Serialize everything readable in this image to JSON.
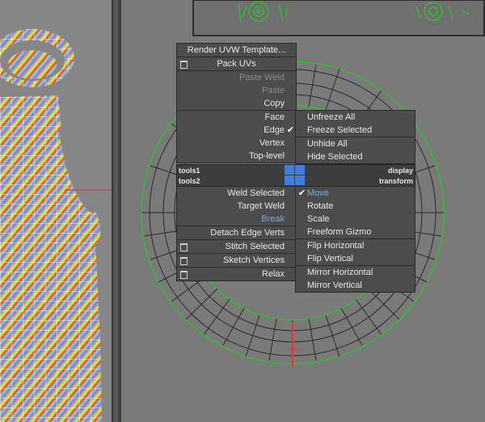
{
  "colors": {
    "seam_green": "#22d022",
    "menu_bg": "#4c4c4c",
    "highlight_blue": "#3f7fe0"
  },
  "quad_left": {
    "items": [
      {
        "label": "Render UVW Template...",
        "state": "normal",
        "align": "center"
      },
      {
        "label": "Pack UVs",
        "state": "normal",
        "align": "center",
        "icon": "box-icon"
      },
      {
        "label": "Paste Weld",
        "state": "disabled"
      },
      {
        "label": "Paste",
        "state": "disabled"
      },
      {
        "label": "Copy",
        "state": "normal"
      },
      {
        "label": "Face",
        "state": "normal"
      },
      {
        "label": "Edge",
        "state": "normal",
        "check": true
      },
      {
        "label": "Vertex",
        "state": "normal"
      },
      {
        "label": "Top-level",
        "state": "normal"
      }
    ]
  },
  "quad_bottom_left": {
    "items": [
      {
        "label": "Weld Selected",
        "state": "normal"
      },
      {
        "label": "Target Weld",
        "state": "normal"
      },
      {
        "label": "Break",
        "state": "blue"
      },
      {
        "label": "Detach Edge Verts",
        "state": "normal"
      },
      {
        "label": "Stitch Selected",
        "state": "normal",
        "icon": "box-icon"
      },
      {
        "label": "Sketch Vertices",
        "state": "normal",
        "icon": "box-icon"
      },
      {
        "label": "Relax",
        "state": "normal",
        "icon": "box-icon"
      }
    ]
  },
  "quad_top_right": {
    "items": [
      {
        "label": "Unfreeze All"
      },
      {
        "label": "Freeze Selected"
      },
      {
        "label": "Unhide All"
      },
      {
        "label": "Hide Selected"
      }
    ]
  },
  "quad_bottom_right": {
    "items": [
      {
        "label": "Move",
        "state": "blue",
        "check": true
      },
      {
        "label": "Rotate"
      },
      {
        "label": "Scale"
      },
      {
        "label": "Freeform Gizmo"
      },
      {
        "label": "Flip Horizontal"
      },
      {
        "label": "Flip Vertical"
      },
      {
        "label": "Mirror Horizontal"
      },
      {
        "label": "Mirror Vertical"
      }
    ]
  },
  "tools_bar": {
    "tools1": "tools1",
    "tools2": "tools2",
    "display": "display",
    "transform": "transform"
  }
}
